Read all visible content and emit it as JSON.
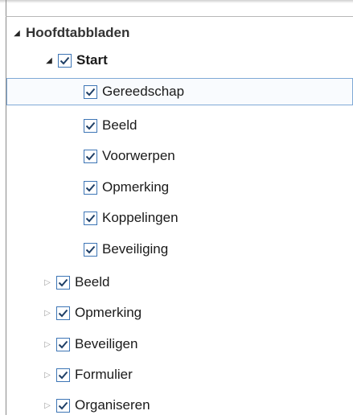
{
  "tree": {
    "root": {
      "label": "Hoofdtabbladen"
    },
    "start": {
      "label": "Start",
      "checked": true,
      "children": [
        {
          "label": "Gereedschap",
          "checked": true
        },
        {
          "label": "Beeld",
          "checked": true
        },
        {
          "label": "Voorwerpen",
          "checked": true
        },
        {
          "label": "Opmerking",
          "checked": true
        },
        {
          "label": "Koppelingen",
          "checked": true
        },
        {
          "label": "Beveiliging",
          "checked": true
        }
      ]
    },
    "tabs": [
      {
        "label": "Beeld",
        "checked": true
      },
      {
        "label": "Opmerking",
        "checked": true
      },
      {
        "label": "Beveiligen",
        "checked": true
      },
      {
        "label": "Formulier",
        "checked": true
      },
      {
        "label": "Organiseren",
        "checked": true
      }
    ]
  },
  "icons": {
    "expanded": "expanded-triangle-icon",
    "collapsed": "collapsed-triangle-icon",
    "check": "checkmark-icon"
  },
  "colors": {
    "selection_border": "#7fa9d6",
    "checkbox_border": "#3d75b5",
    "check": "#1f3f66"
  }
}
